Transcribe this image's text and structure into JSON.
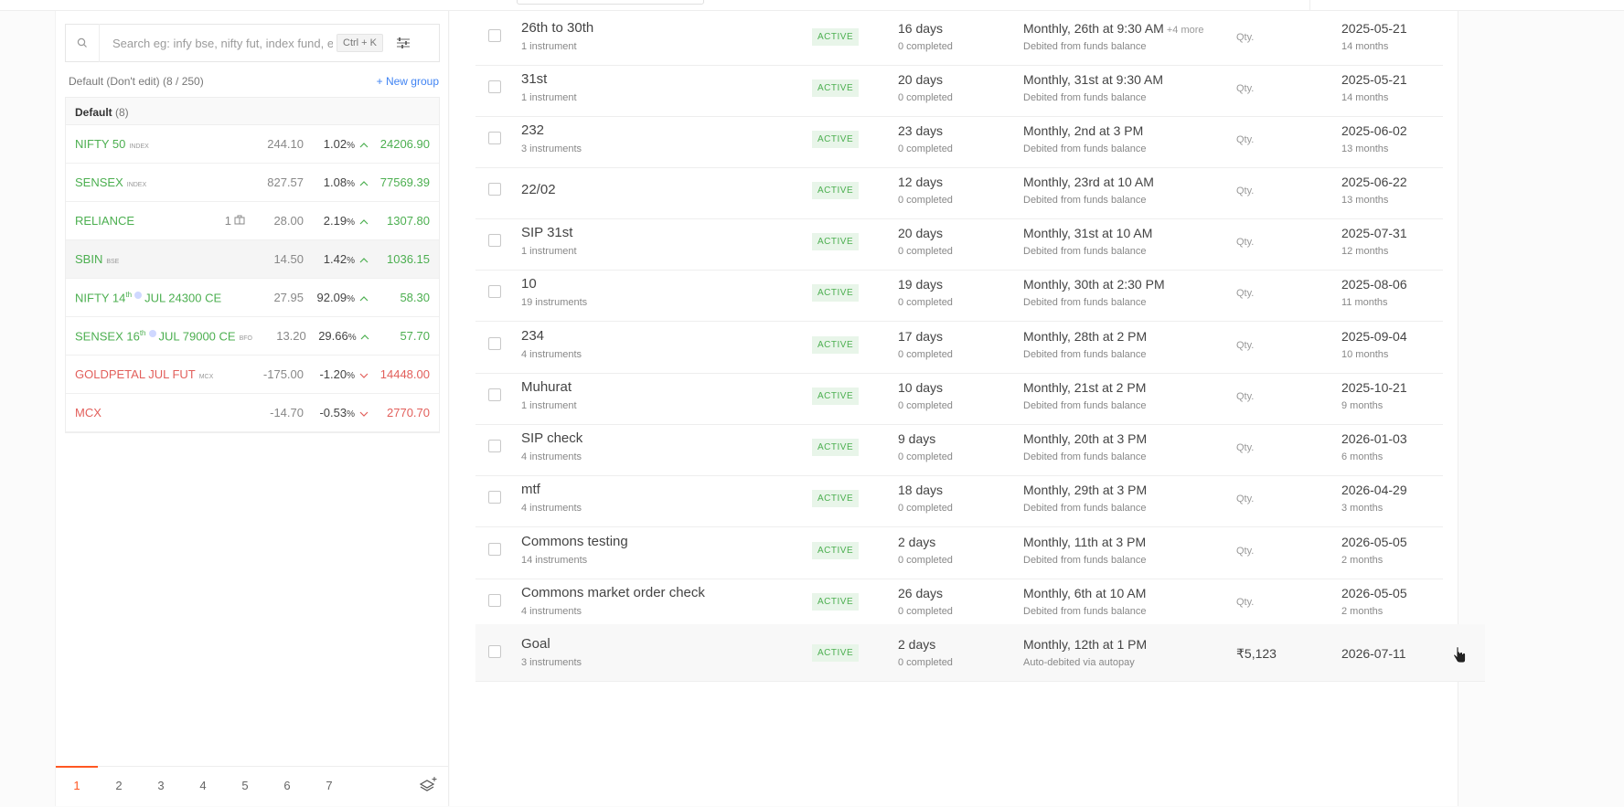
{
  "search": {
    "placeholder": "Search eg: infy bse, nifty fut, index fund, et",
    "shortcut": "Ctrl + K"
  },
  "group": {
    "name": "Default (Don't edit)",
    "count": "(8 / 250)",
    "new_group": "+ New group"
  },
  "watchlist": {
    "title": "Default",
    "count": "(8)",
    "items": [
      {
        "name": "NIFTY 50",
        "tag": "INDEX",
        "change": "244.10",
        "pct": "1.02",
        "ltp": "24206.90",
        "dir": "up"
      },
      {
        "name": "SENSEX",
        "tag": "INDEX",
        "change": "827.57",
        "pct": "1.08",
        "ltp": "77569.39",
        "dir": "up"
      },
      {
        "name": "RELIANCE",
        "tag": "",
        "holding": "1",
        "change": "28.00",
        "pct": "2.19",
        "ltp": "1307.80",
        "dir": "up"
      },
      {
        "name": "SBIN",
        "tag": "BSE",
        "change": "14.50",
        "pct": "1.42",
        "ltp": "1036.15",
        "dir": "up"
      },
      {
        "name_pre": "NIFTY 14",
        "sup": "th",
        "name_post": "JUL 24300 CE",
        "tag": "",
        "change": "27.95",
        "pct": "92.09",
        "ltp": "58.30",
        "dir": "up"
      },
      {
        "name_pre": "SENSEX 16",
        "sup": "th",
        "name_post": "JUL 79000 CE",
        "tag": "BFO",
        "change": "13.20",
        "pct": "29.66",
        "ltp": "57.70",
        "dir": "up"
      },
      {
        "name": "GOLDPETAL JUL FUT",
        "tag": "MCX",
        "change": "-175.00",
        "pct": "-1.20",
        "ltp": "14448.00",
        "dir": "down"
      },
      {
        "name": "MCX",
        "tag": "",
        "change": "-14.70",
        "pct": "-0.53",
        "ltp": "2770.70",
        "dir": "down"
      }
    ],
    "pct_sign": "%"
  },
  "pager": {
    "pages": [
      "1",
      "2",
      "3",
      "4",
      "5",
      "6",
      "7"
    ],
    "active": "1"
  },
  "sips": [
    {
      "name": "26th to 30th",
      "instruments": "1 instrument",
      "status": "ACTIVE",
      "days": "16 days",
      "completed": "0 completed",
      "frequency": "Monthly, 26th at 9:30 AM",
      "more": "+4 more",
      "funding": "Debited from funds balance",
      "qty": "Qty.",
      "date": "2025-05-21",
      "duration": "14 months"
    },
    {
      "name": "31st",
      "instruments": "1 instrument",
      "status": "ACTIVE",
      "days": "20 days",
      "completed": "0 completed",
      "frequency": "Monthly, 31st at 9:30 AM",
      "funding": "Debited from funds balance",
      "qty": "Qty.",
      "date": "2025-05-21",
      "duration": "14 months"
    },
    {
      "name": "232",
      "instruments": "3 instruments",
      "status": "ACTIVE",
      "days": "23 days",
      "completed": "0 completed",
      "frequency": "Monthly, 2nd at 3 PM",
      "funding": "Debited from funds balance",
      "qty": "Qty.",
      "date": "2025-06-02",
      "duration": "13 months"
    },
    {
      "name": "22/02",
      "instruments": "",
      "status": "ACTIVE",
      "days": "12 days",
      "completed": "0 completed",
      "frequency": "Monthly, 23rd at 10 AM",
      "funding": "Debited from funds balance",
      "qty": "Qty.",
      "date": "2025-06-22",
      "duration": "13 months"
    },
    {
      "name": "SIP 31st",
      "instruments": "1 instrument",
      "status": "ACTIVE",
      "days": "20 days",
      "completed": "0 completed",
      "frequency": "Monthly, 31st at 10 AM",
      "funding": "Debited from funds balance",
      "qty": "Qty.",
      "date": "2025-07-31",
      "duration": "12 months"
    },
    {
      "name": "10",
      "instruments": "19 instruments",
      "status": "ACTIVE",
      "days": "19 days",
      "completed": "0 completed",
      "frequency": "Monthly, 30th at 2:30 PM",
      "funding": "Debited from funds balance",
      "qty": "Qty.",
      "date": "2025-08-06",
      "duration": "11 months"
    },
    {
      "name": "234",
      "instruments": "4 instruments",
      "status": "ACTIVE",
      "days": "17 days",
      "completed": "0 completed",
      "frequency": "Monthly, 28th at 2 PM",
      "funding": "Debited from funds balance",
      "qty": "Qty.",
      "date": "2025-09-04",
      "duration": "10 months"
    },
    {
      "name": "Muhurat",
      "instruments": "1 instrument",
      "status": "ACTIVE",
      "days": "10 days",
      "completed": "0 completed",
      "frequency": "Monthly, 21st at 2 PM",
      "funding": "Debited from funds balance",
      "qty": "Qty.",
      "date": "2025-10-21",
      "duration": "9 months"
    },
    {
      "name": "SIP check",
      "instruments": "4 instruments",
      "status": "ACTIVE",
      "days": "9 days",
      "completed": "0 completed",
      "frequency": "Monthly, 20th at 3 PM",
      "funding": "Debited from funds balance",
      "qty": "Qty.",
      "date": "2026-01-03",
      "duration": "6 months"
    },
    {
      "name": "mtf",
      "instruments": "4 instruments",
      "status": "ACTIVE",
      "days": "18 days",
      "completed": "0 completed",
      "frequency": "Monthly, 29th at 3 PM",
      "funding": "Debited from funds balance",
      "qty": "Qty.",
      "date": "2026-04-29",
      "duration": "3 months"
    },
    {
      "name": "Commons testing",
      "instruments": "14 instruments",
      "status": "ACTIVE",
      "days": "2 days",
      "completed": "0 completed",
      "frequency": "Monthly, 11th at 3 PM",
      "funding": "Debited from funds balance",
      "qty": "Qty.",
      "date": "2026-05-05",
      "duration": "2 months"
    },
    {
      "name": "Commons market order check",
      "instruments": "4 instruments",
      "status": "ACTIVE",
      "days": "26 days",
      "completed": "0 completed",
      "frequency": "Monthly, 6th at 10 AM",
      "funding": "Debited from funds balance",
      "qty": "Qty.",
      "date": "2026-05-05",
      "duration": "2 months"
    },
    {
      "name": "Goal",
      "instruments": "3 instruments",
      "status": "ACTIVE",
      "days": "2 days",
      "completed": "0 completed",
      "frequency": "Monthly, 12th at 1 PM",
      "funding": "Auto-debited via autopay",
      "qty": "₹5,123",
      "date": "2026-07-11",
      "duration": ""
    }
  ],
  "colors": {
    "positive": "#4caf50",
    "negative": "#e25f5b",
    "accent": "#ff5722",
    "link": "#4184f3"
  }
}
